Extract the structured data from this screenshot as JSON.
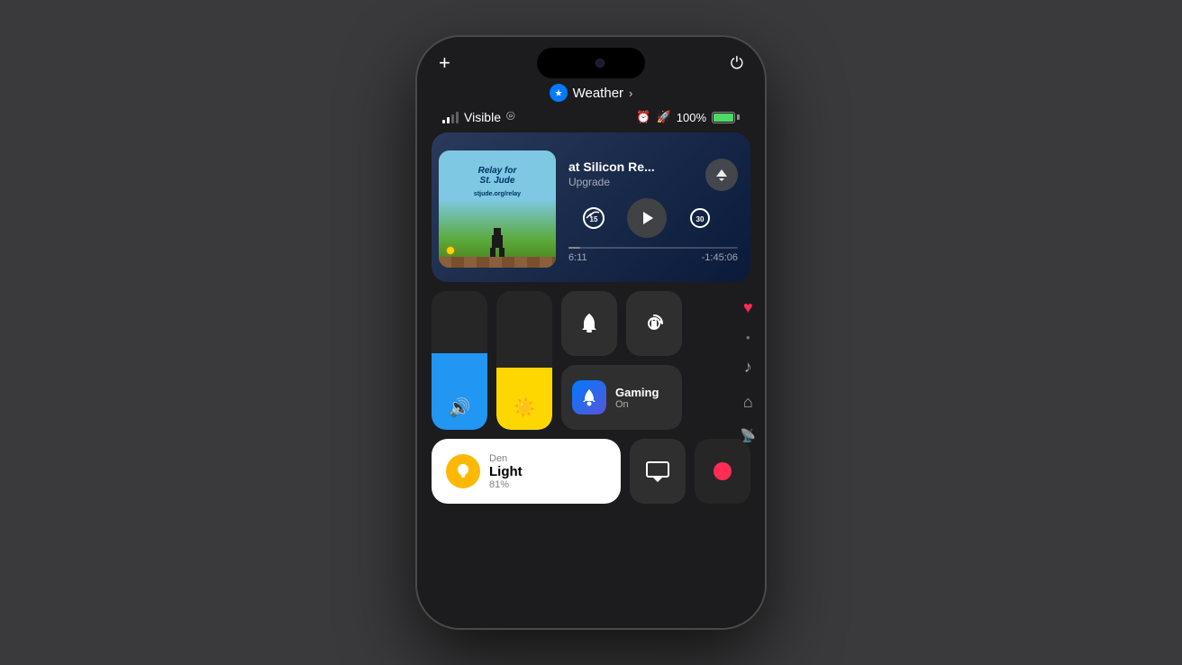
{
  "phone": {
    "background_color": "#3a3a3c"
  },
  "top_bar": {
    "plus_label": "+",
    "power_icon": "⏻"
  },
  "weather_bar": {
    "label": "Weather",
    "chevron": "›"
  },
  "status_bar": {
    "carrier": "Visible",
    "wifi_icon": "wifi",
    "alarm_icon": "⏰",
    "rocket_icon": "🚀",
    "battery_percent": "100%"
  },
  "podcast": {
    "artwork_title": "Relay for St. Jude",
    "artwork_url": "stjude.org/relay",
    "episode_title": "at Silicon",
    "episode_suffix": "Re...",
    "action_label": "Upgrade",
    "time_current": "6:11",
    "time_remaining": "-1:45:06",
    "skip_back": "15",
    "skip_forward": "30",
    "progress_percent": 7
  },
  "control_center": {
    "volume_icon": "🔊",
    "brightness_icon": "☀",
    "bell_label": "Bell",
    "lock_rotation_label": "Lock",
    "heart_icon": "♥",
    "gaming": {
      "title": "Gaming",
      "status": "On"
    },
    "light": {
      "room": "Den",
      "name": "Light",
      "percent": "81%"
    },
    "right_icons": [
      "♥",
      "•",
      "♪",
      "⌂",
      "((•))"
    ]
  }
}
